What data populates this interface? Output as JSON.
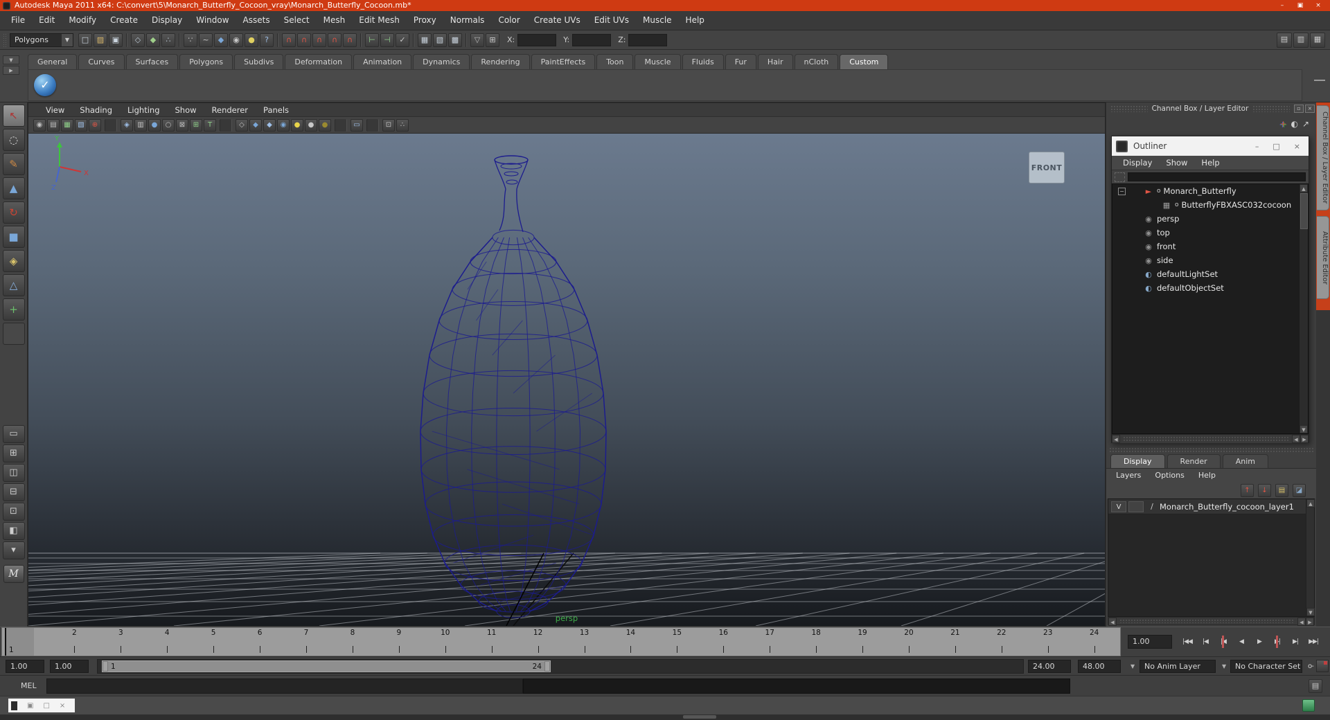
{
  "window": {
    "title": "Autodesk Maya 2011 x64: C:\\convert\\5\\Monarch_Butterfly_Cocoon_vray\\Monarch_Butterfly_Cocoon.mb*",
    "controls": [
      {
        "name": "minimize-button",
        "glyph": "–"
      },
      {
        "name": "restore-button",
        "glyph": "▣"
      },
      {
        "name": "close-button",
        "glyph": "×"
      }
    ]
  },
  "menu_bar": {
    "items": [
      "File",
      "Edit",
      "Modify",
      "Create",
      "Display",
      "Window",
      "Assets",
      "Select",
      "Mesh",
      "Edit Mesh",
      "Proxy",
      "Normals",
      "Color",
      "Create UVs",
      "Edit UVs",
      "Muscle",
      "Help"
    ]
  },
  "status_line": {
    "mode_selector": "Polygons",
    "icons": [
      {
        "name": "new-scene-icon",
        "glyph": "□",
        "color": "#ccd6e0"
      },
      {
        "name": "open-scene-icon",
        "glyph": "▨",
        "color": "#d8b66a"
      },
      {
        "name": "save-scene-icon",
        "glyph": "▣",
        "color": "#ccd6e0"
      },
      {
        "name": "",
        "glyph": "",
        "type": "type-sep"
      },
      {
        "name": "select-hierarchy-icon",
        "glyph": "◇",
        "color": "#b8c4d0"
      },
      {
        "name": "select-object-icon",
        "glyph": "◆",
        "color": "#9fd08a"
      },
      {
        "name": "select-component-icon",
        "glyph": "∴",
        "color": "#b8c4d0"
      },
      {
        "name": "",
        "glyph": "",
        "type": "type-sep"
      },
      {
        "name": "select-points-mask-icon",
        "glyph": "∵",
        "color": "#c8c8c8"
      },
      {
        "name": "select-curves-mask-icon",
        "glyph": "~",
        "color": "#c8c8c8"
      },
      {
        "name": "select-surfaces-mask-icon",
        "glyph": "◆",
        "color": "#7aa7d8"
      },
      {
        "name": "select-deformations-mask-icon",
        "glyph": "◉",
        "color": "#c8c8c8"
      },
      {
        "name": "select-rendering-mask-icon",
        "glyph": "●",
        "color": "#e0d060"
      },
      {
        "name": "select-misc-mask-icon",
        "glyph": "?",
        "color": "#9fc0e8"
      },
      {
        "name": "",
        "glyph": "",
        "type": "type-sep"
      },
      {
        "name": "snap-to-grid-icon",
        "glyph": "∩",
        "color": "#e05545"
      },
      {
        "name": "snap-to-curve-icon",
        "glyph": "∩",
        "color": "#e05545"
      },
      {
        "name": "snap-to-point-icon",
        "glyph": "∩",
        "color": "#e05545"
      },
      {
        "name": "snap-to-view-plane-icon",
        "glyph": "∩",
        "color": "#e05545"
      },
      {
        "name": "make-live-icon",
        "glyph": "∩",
        "color": "#e05545"
      },
      {
        "name": "",
        "glyph": "",
        "type": "type-sep"
      },
      {
        "name": "input-connections-icon",
        "glyph": "⊢",
        "color": "#8fd08a"
      },
      {
        "name": "output-connections-icon",
        "glyph": "⊣",
        "color": "#8fd08a"
      },
      {
        "name": "construction-history-icon",
        "glyph": "✓",
        "color": "#c8c8c8"
      },
      {
        "name": "",
        "glyph": "",
        "type": "type-sep"
      },
      {
        "name": "render-current-frame-icon",
        "glyph": "▦",
        "color": "#c8d2dc"
      },
      {
        "name": "ipr-render-icon",
        "glyph": "▧",
        "color": "#c8d2dc"
      },
      {
        "name": "render-settings-icon",
        "glyph": "▩",
        "color": "#c8d2dc"
      },
      {
        "name": "",
        "glyph": "",
        "type": "type-sep"
      },
      {
        "name": "field-entry-mode-icon",
        "glyph": "▽",
        "color": "#b8b8b8"
      },
      {
        "name": "absolute-transform-icon",
        "glyph": "⊞",
        "color": "#c8c8c8"
      }
    ],
    "coords": [
      {
        "label": "X:"
      },
      {
        "label": "Y:"
      },
      {
        "label": "Z:"
      }
    ],
    "right_toggles": [
      {
        "name": "attribute-editor-toggle",
        "glyph": "▤"
      },
      {
        "name": "tool-settings-toggle",
        "glyph": "▥"
      },
      {
        "name": "channel-box-toggle",
        "glyph": "▦"
      }
    ]
  },
  "shelf": {
    "tabs": [
      {
        "label": "General"
      },
      {
        "label": "Curves"
      },
      {
        "label": "Surfaces"
      },
      {
        "label": "Polygons"
      },
      {
        "label": "Subdivs"
      },
      {
        "label": "Deformation"
      },
      {
        "label": "Animation"
      },
      {
        "label": "Dynamics"
      },
      {
        "label": "Rendering"
      },
      {
        "label": "PaintEffects"
      },
      {
        "label": "Toon"
      },
      {
        "label": "Muscle"
      },
      {
        "label": "Fluids"
      },
      {
        "label": "Fur"
      },
      {
        "label": "Hair"
      },
      {
        "label": "nCloth"
      },
      {
        "label": "Custom",
        "state": "active"
      }
    ],
    "items": [
      {
        "name": "custom-shelf-item",
        "glyph": "✓"
      }
    ]
  },
  "toolbox": {
    "tools": [
      {
        "name": "select-tool",
        "glyph": "↖",
        "color": "#b03030",
        "state": "active"
      },
      {
        "name": "lasso-select-tool",
        "glyph": "◌",
        "color": "#e0e0e0"
      },
      {
        "name": "paint-selection-tool",
        "glyph": "✎",
        "color": "#cc8844"
      },
      {
        "name": "move-tool",
        "glyph": "▲",
        "color": "#7aa7d8"
      },
      {
        "name": "rotate-tool",
        "glyph": "↻",
        "color": "#cc4433"
      },
      {
        "name": "scale-tool",
        "glyph": "■",
        "color": "#7aa7d8"
      },
      {
        "name": "universal-manipulator-tool",
        "glyph": "◈",
        "color": "#d8c26a"
      },
      {
        "name": "soft-modification-tool",
        "glyph": "△",
        "color": "#88b0e0"
      },
      {
        "name": "show-manipulator-tool",
        "glyph": "+",
        "color": "#6cc06c"
      },
      {
        "name": "last-tool-slot",
        "glyph": "",
        "color": "#888",
        "state": "empty"
      }
    ],
    "layouts": [
      {
        "name": "single-pane-layout-button",
        "glyph": "▭"
      },
      {
        "name": "four-pane-layout-button",
        "glyph": "⊞"
      },
      {
        "name": "outliner-persp-layout-button",
        "glyph": "◫"
      },
      {
        "name": "persp-graph-layout-button",
        "glyph": "⊟"
      },
      {
        "name": "hypershade-persp-layout-button",
        "glyph": "⊡"
      },
      {
        "name": "persp-outliner-graph-layout-button",
        "glyph": "◧"
      },
      {
        "name": "layout-menu-button",
        "glyph": "▾"
      }
    ],
    "logo_glyph": "M"
  },
  "viewport": {
    "menus": [
      "View",
      "Shading",
      "Lighting",
      "Show",
      "Renderer",
      "Panels"
    ],
    "toolbar": [
      {
        "name": "select-camera-icon",
        "glyph": "◉",
        "color": "#c0c0c0"
      },
      {
        "name": "camera-attributes-icon",
        "glyph": "▤",
        "color": "#c0c0c0"
      },
      {
        "name": "bookmarks-icon",
        "glyph": "▦",
        "color": "#8fd08a"
      },
      {
        "name": "image-plane-icon",
        "glyph": "▧",
        "color": "#9fc0e8"
      },
      {
        "name": "2d-pan-zoom-icon",
        "glyph": "⊕",
        "color": "#e05545"
      },
      {
        "name": "",
        "glyph": "",
        "type": "type-sep"
      },
      {
        "name": "isolate-select-icon",
        "glyph": "◈",
        "color": "#9fc0e8"
      },
      {
        "name": "film-gate-icon",
        "glyph": "▥",
        "color": "#c0c0c0"
      },
      {
        "name": "resolution-gate-icon",
        "glyph": "●",
        "color": "#7aa7d8"
      },
      {
        "name": "gate-mask-icon",
        "glyph": "○",
        "color": "#c0c0c0"
      },
      {
        "name": "field-chart-icon",
        "glyph": "⊠",
        "color": "#c0c0c0"
      },
      {
        "name": "safe-action-icon",
        "glyph": "⊞",
        "color": "#8fd08a"
      },
      {
        "name": "safe-title-icon",
        "glyph": "T",
        "color": "#8fd08a"
      },
      {
        "name": "",
        "glyph": "",
        "type": "type-sep"
      },
      {
        "name": "wireframe-icon",
        "glyph": "◇",
        "color": "#c0c0c0"
      },
      {
        "name": "smooth-shade-icon",
        "glyph": "◆",
        "color": "#7aa7d8"
      },
      {
        "name": "smooth-shade-all-icon",
        "glyph": "◆",
        "color": "#9fc0e8"
      },
      {
        "name": "textured-icon",
        "glyph": "◉",
        "color": "#7aa7d8"
      },
      {
        "name": "use-default-lighting-icon",
        "glyph": "●",
        "color": "#e8d44a"
      },
      {
        "name": "use-all-lights-icon",
        "glyph": "●",
        "color": "#c8c8c8"
      },
      {
        "name": "use-no-lights-icon",
        "glyph": "●",
        "color": "#9a8a30"
      },
      {
        "name": "",
        "glyph": "",
        "type": "type-sep"
      },
      {
        "name": "xray-icon",
        "glyph": "▭",
        "color": "#9fc0e8"
      },
      {
        "name": "",
        "glyph": "",
        "type": "type-sep"
      },
      {
        "name": "isolate-selected-icon",
        "glyph": "⊡",
        "color": "#c0c0c0"
      },
      {
        "name": "share-view-icon",
        "glyph": "∴",
        "color": "#c0c0c0"
      }
    ],
    "viewcube_label": "FRONT",
    "camera_label": "persp",
    "axis": {
      "x": "X",
      "y": "Y",
      "z": "Z"
    }
  },
  "channel_box": {
    "title": "Channel Box / Layer Editor",
    "manip_icons": [
      {
        "name": "manip-axis-icon",
        "glyph": "+",
        "cls": "rgb"
      },
      {
        "name": "manip-state-icon",
        "glyph": "◐"
      },
      {
        "name": "manip-arrow-icon",
        "glyph": "↗"
      }
    ]
  },
  "side_tabs": [
    {
      "label": "Channel Box / Layer Editor"
    },
    {
      "label": "Attribute Editor"
    }
  ],
  "outliner": {
    "title": "Outliner",
    "menus": [
      "Display",
      "Show",
      "Help"
    ],
    "items": [
      {
        "label": "Monarch_Butterfly",
        "icon": "ic-transform",
        "iglyph": "►",
        "depth": "d1",
        "conn": "o",
        "gutter": "−"
      },
      {
        "label": "ButterflyFBXASC032cocoon",
        "icon": "ic-mesh",
        "iglyph": "▦",
        "depth": "d2",
        "conn": "o",
        "gutter": ""
      },
      {
        "label": "persp",
        "icon": "ic-camera",
        "iglyph": "◉",
        "depth": "d1",
        "state": "muted",
        "conn": "",
        "gutter": ""
      },
      {
        "label": "top",
        "icon": "ic-camera",
        "iglyph": "◉",
        "depth": "d1",
        "state": "muted",
        "conn": "",
        "gutter": ""
      },
      {
        "label": "front",
        "icon": "ic-camera",
        "iglyph": "◉",
        "depth": "d1",
        "state": "muted",
        "conn": "",
        "gutter": ""
      },
      {
        "label": "side",
        "icon": "ic-camera",
        "iglyph": "◉",
        "depth": "d1",
        "state": "muted",
        "conn": "",
        "gutter": ""
      },
      {
        "label": "defaultLightSet",
        "icon": "ic-set",
        "iglyph": "◐",
        "depth": "d1",
        "conn": "",
        "gutter": ""
      },
      {
        "label": "defaultObjectSet",
        "icon": "ic-set",
        "iglyph": "◐",
        "depth": "d1",
        "conn": "",
        "gutter": ""
      }
    ]
  },
  "layer_editor": {
    "tabs": [
      {
        "label": "Display",
        "state": "active"
      },
      {
        "label": "Render"
      },
      {
        "label": "Anim"
      }
    ],
    "menus": [
      "Layers",
      "Options",
      "Help"
    ],
    "icons": [
      {
        "name": "move-layer-up-icon",
        "glyph": "↑",
        "color": "#e05545"
      },
      {
        "name": "move-layer-down-icon",
        "glyph": "↓",
        "color": "#e05545"
      },
      {
        "name": "create-empty-layer-icon",
        "glyph": "▤",
        "color": "#d8c26a"
      },
      {
        "name": "create-layer-from-selected-icon",
        "glyph": "◪",
        "color": "#86a7c8"
      }
    ],
    "layers": [
      {
        "vis": "V",
        "tri": "∕",
        "name": "Monarch_Butterfly_cocoon_layer1"
      }
    ]
  },
  "time_slider": {
    "numbers": [
      "1",
      "2",
      "3",
      "4",
      "5",
      "6",
      "7",
      "8",
      "9",
      "10",
      "11",
      "12",
      "13",
      "14",
      "15",
      "16",
      "17",
      "18",
      "19",
      "20",
      "21",
      "22",
      "23",
      "24"
    ],
    "current_frame": "1",
    "current_time": "1.00"
  },
  "playback": {
    "buttons": [
      {
        "name": "go-to-start-button",
        "glyph": "|◀◀"
      },
      {
        "name": "step-back-frame-button",
        "glyph": "|◀"
      },
      {
        "name": "step-back-key-button",
        "glyph": "|◀",
        "state": "accent"
      },
      {
        "name": "play-backwards-button",
        "glyph": "◀"
      },
      {
        "name": "play-forwards-button",
        "glyph": "▶"
      },
      {
        "name": "step-forward-key-button",
        "glyph": "▶|",
        "state": "accent"
      },
      {
        "name": "step-forward-frame-button",
        "glyph": "▶|"
      },
      {
        "name": "go-to-end-button",
        "glyph": "▶▶|"
      }
    ]
  },
  "range_slider": {
    "anim_start": "1.00",
    "playback_start": "1.00",
    "bar_start_label": "1",
    "bar_end_label": "24",
    "playback_end": "24.00",
    "anim_end": "48.00",
    "anim_layer": "No Anim Layer",
    "character_set": "No Character Set",
    "key_glyph": "o-"
  },
  "command_line": {
    "label": "MEL"
  },
  "ui": {
    "up": "▲",
    "down": "▼",
    "left": "◀",
    "right": "▶",
    "dropdown": "▼",
    "minimize": "–",
    "maximize": "□",
    "restore": "▣",
    "close": "×",
    "collapse": "−",
    "float": "▫"
  },
  "colors": {
    "titlebar_orange": "#cf3a12",
    "wireframe_blue": "#1c1c8e",
    "grid_line": "rgba(205,210,216,0.5)",
    "persp_green": "#3fae4a",
    "axis_x_red": "#d03535",
    "axis_y_green": "#3ec43e",
    "axis_z_blue": "#4565d0"
  }
}
